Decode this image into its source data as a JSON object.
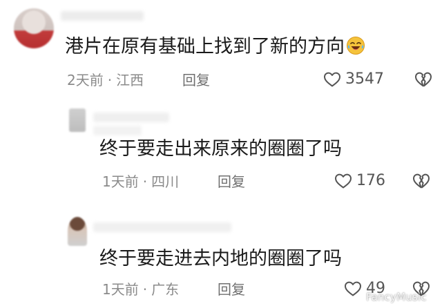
{
  "comments": [
    {
      "text": "港片在原有基础上找到了新的方向",
      "emoji": "laughing-crying-emoji",
      "time": "2天前",
      "location": "江西",
      "reply_label": "回复",
      "likes": "3547"
    },
    {
      "text": "终于要走出来原来的圈圈了吗",
      "time": "1天前",
      "location": "四川",
      "reply_label": "回复",
      "likes": "176"
    },
    {
      "text": "终于要走进去内地的圈圈了吗",
      "time": "1天前",
      "location": "广东",
      "reply_label": "回复",
      "likes": "49"
    }
  ],
  "separator": "·",
  "watermark": "FancyMusic",
  "icons": {
    "like": "heart-outline-icon",
    "dislike": "broken-heart-icon"
  },
  "colors": {
    "text": "#1a1a1a",
    "meta": "#8a8a8a",
    "icon": "#555555",
    "emoji": "#f5c33b"
  }
}
